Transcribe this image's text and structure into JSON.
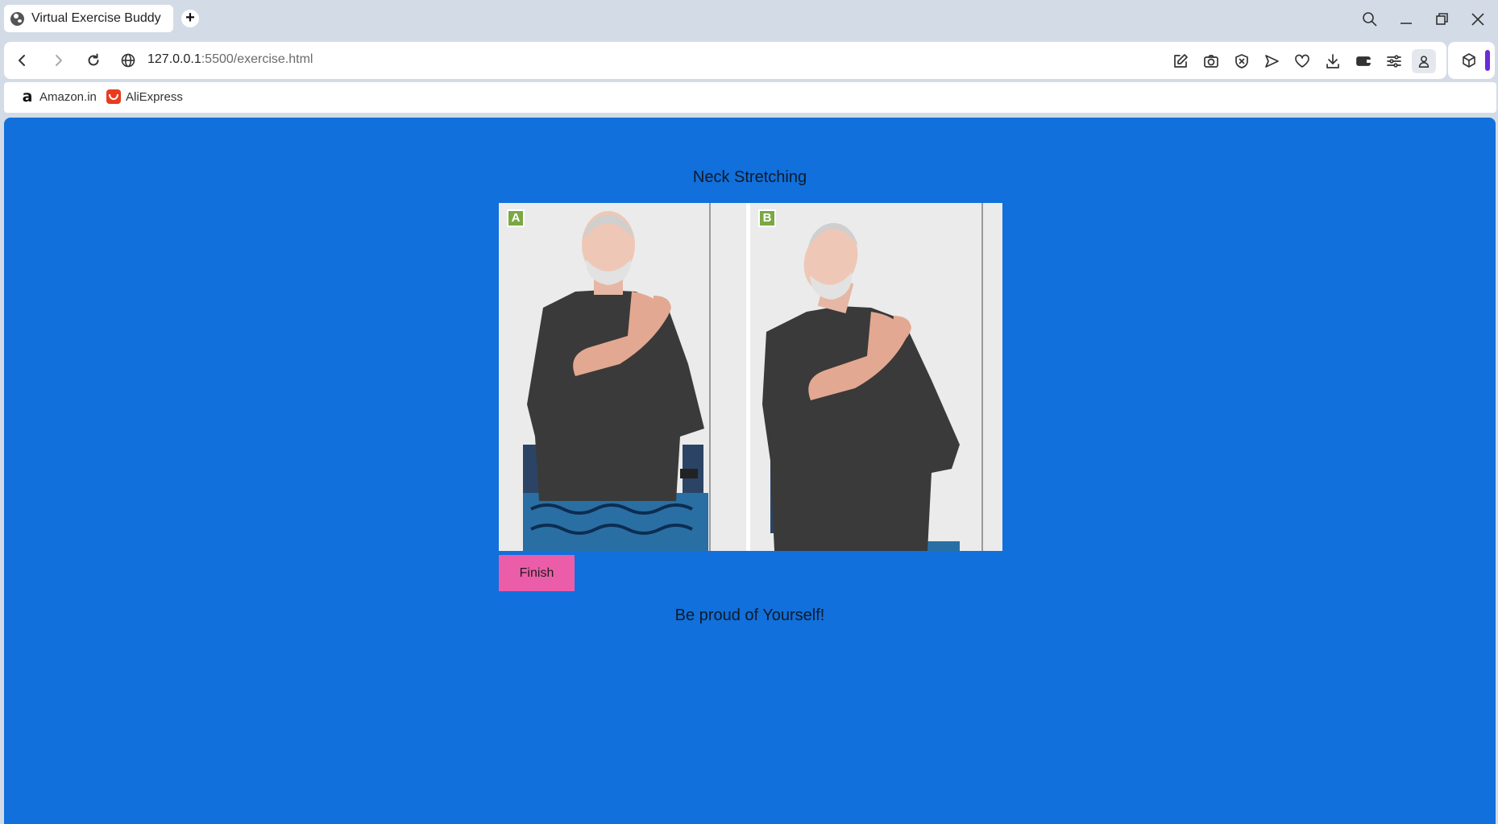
{
  "browser": {
    "tab": {
      "title": "Virtual Exercise Buddy",
      "icon": "globe-icon"
    },
    "new_tab_icon": "plus-icon",
    "address": {
      "host": "127.0.0.1",
      "rest": ":5500/exercise.html"
    },
    "bookmarks": [
      {
        "label": "Amazon.in",
        "icon": "amazon-icon"
      },
      {
        "label": "AliExpress",
        "icon": "aliexpress-icon"
      }
    ],
    "accent_color": "#6a2bd9"
  },
  "page": {
    "background": "#1170db",
    "exercise_title": "Neck Stretching",
    "image": {
      "panels": [
        {
          "label": "A",
          "description": "seated, head upright, right hand on left shoulder"
        },
        {
          "label": "B",
          "description": "seated, head tilted to right, right hand on left shoulder"
        }
      ],
      "badge_color": "#7aa842"
    },
    "finish_button": {
      "label": "Finish",
      "color": "#ec5da9"
    },
    "message": "Be proud of Yourself!"
  }
}
